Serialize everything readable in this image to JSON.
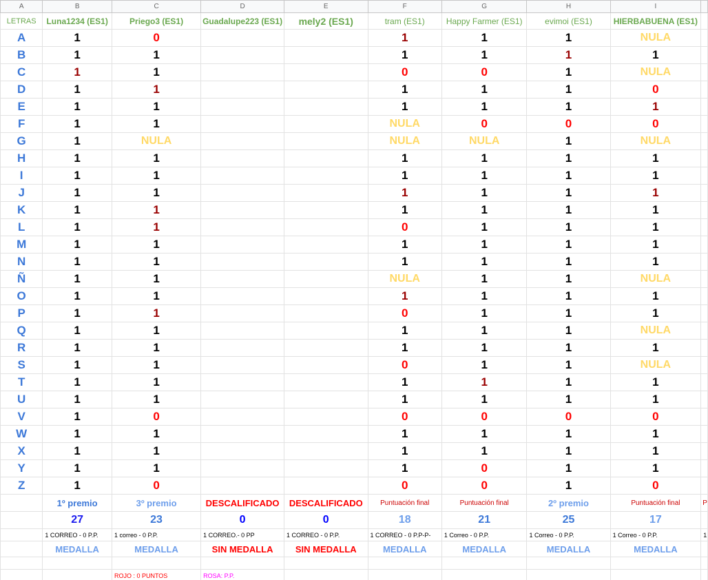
{
  "columns": [
    "A",
    "B",
    "C",
    "D",
    "E",
    "F",
    "G",
    "H",
    "I"
  ],
  "header_label": "LETRAS",
  "players": [
    "Luna1234 (ES1)",
    "Priego3 (ES1)",
    "Guadalupe223 (ES1)",
    "mely2 (ES1)",
    "tram (ES1)",
    "Happy Farmer (ES1)",
    "evimoi (ES1)",
    "HIERBABUENA (ES1)"
  ],
  "rows": [
    {
      "letter": "A",
      "values": [
        "1",
        "0",
        "",
        "",
        "1",
        "1",
        "1",
        "NULA"
      ]
    },
    {
      "letter": "B",
      "values": [
        "1",
        "1",
        "",
        "",
        "1",
        "1",
        "1",
        "1"
      ]
    },
    {
      "letter": "C",
      "values": [
        "1",
        "1",
        "",
        "",
        "0",
        "0",
        "1",
        "NULA"
      ]
    },
    {
      "letter": "D",
      "values": [
        "1",
        "1",
        "",
        "",
        "1",
        "1",
        "1",
        "0"
      ]
    },
    {
      "letter": "E",
      "values": [
        "1",
        "1",
        "",
        "",
        "1",
        "1",
        "1",
        "1"
      ]
    },
    {
      "letter": "F",
      "values": [
        "1",
        "1",
        "",
        "",
        "NULA",
        "0",
        "0",
        "0"
      ]
    },
    {
      "letter": "G",
      "values": [
        "1",
        "NULA",
        "",
        "",
        "NULA",
        "NULA",
        "1",
        "NULA"
      ]
    },
    {
      "letter": "H",
      "values": [
        "1",
        "1",
        "",
        "",
        "1",
        "1",
        "1",
        "1"
      ]
    },
    {
      "letter": "I",
      "values": [
        "1",
        "1",
        "",
        "",
        "1",
        "1",
        "1",
        "1"
      ]
    },
    {
      "letter": "J",
      "values": [
        "1",
        "1",
        "",
        "",
        "1",
        "1",
        "1",
        "1"
      ]
    },
    {
      "letter": "K",
      "values": [
        "1",
        "1",
        "",
        "",
        "1",
        "1",
        "1",
        "1"
      ]
    },
    {
      "letter": "L",
      "values": [
        "1",
        "1",
        "",
        "",
        "0",
        "1",
        "1",
        "1"
      ]
    },
    {
      "letter": "M",
      "values": [
        "1",
        "1",
        "",
        "",
        "1",
        "1",
        "1",
        "1"
      ]
    },
    {
      "letter": "N",
      "values": [
        "1",
        "1",
        "",
        "",
        "1",
        "1",
        "1",
        "1"
      ]
    },
    {
      "letter": "Ñ",
      "values": [
        "1",
        "1",
        "",
        "",
        "NULA",
        "1",
        "1",
        "NULA"
      ]
    },
    {
      "letter": "O",
      "values": [
        "1",
        "1",
        "",
        "",
        "1",
        "1",
        "1",
        "1"
      ]
    },
    {
      "letter": "P",
      "values": [
        "1",
        "1",
        "",
        "",
        "0",
        "1",
        "1",
        "1"
      ]
    },
    {
      "letter": "Q",
      "values": [
        "1",
        "1",
        "",
        "",
        "1",
        "1",
        "1",
        "NULA"
      ]
    },
    {
      "letter": "R",
      "values": [
        "1",
        "1",
        "",
        "",
        "1",
        "1",
        "1",
        "1"
      ]
    },
    {
      "letter": "S",
      "values": [
        "1",
        "1",
        "",
        "",
        "0",
        "1",
        "1",
        "NULA"
      ]
    },
    {
      "letter": "T",
      "values": [
        "1",
        "1",
        "",
        "",
        "1",
        "1",
        "1",
        "1"
      ]
    },
    {
      "letter": "U",
      "values": [
        "1",
        "1",
        "",
        "",
        "1",
        "1",
        "1",
        "1"
      ]
    },
    {
      "letter": "V",
      "values": [
        "1",
        "0",
        "",
        "",
        "0",
        "0",
        "0",
        "0"
      ]
    },
    {
      "letter": "W",
      "values": [
        "1",
        "1",
        "",
        "",
        "1",
        "1",
        "1",
        "1"
      ]
    },
    {
      "letter": "X",
      "values": [
        "1",
        "1",
        "",
        "",
        "1",
        "1",
        "1",
        "1"
      ]
    },
    {
      "letter": "Y",
      "values": [
        "1",
        "1",
        "",
        "",
        "1",
        "0",
        "1",
        "1"
      ]
    },
    {
      "letter": "Z",
      "values": [
        "1",
        "0",
        "",
        "",
        "0",
        "0",
        "1",
        "0"
      ]
    }
  ],
  "dark_red_cells": [
    "B:C",
    "C:D",
    "C:K",
    "C:L",
    "C:P",
    "F:A",
    "F:J",
    "F:O",
    "G:T",
    "H:B",
    "I:E",
    "I:J"
  ],
  "premios": [
    "1º premio",
    "3º premio",
    "DESCALIFICADO",
    "DESCALIFICADO",
    "Puntuación final",
    "Puntuación final",
    "2º premio",
    "Puntuación final",
    "P"
  ],
  "scores": [
    "27",
    "23",
    "0",
    "0",
    "18",
    "21",
    "25",
    "17"
  ],
  "correos": [
    "1 CORREO - 0 P.P.",
    "1 correo - 0 P.P.",
    "1 CORREO.- 0 PP",
    "1 CORREO - 0 P.P.",
    "1 CORREO - 0 P.P-P-",
    "1 Correo - 0  P.P.",
    "1 Correo - 0 P.P.",
    "1 Correo - 0 P.P.",
    "1"
  ],
  "medallas": [
    "MEDALLA",
    "MEDALLA",
    "SIN MEDALLA",
    "SIN MEDALLA",
    "MEDALLA",
    "MEDALLA",
    "MEDALLA",
    "MEDALLA"
  ],
  "legend": {
    "rojo": "ROJO : 0 PUNTOS",
    "rosa": "ROSA: P.P."
  },
  "colors": {
    "letter": "#3c78d8",
    "name": "#6aa84f",
    "zero": "#ff0000",
    "dark_red": "#990000",
    "nula": "#ffd966",
    "prize": "#6d9eeb",
    "disqualified": "#ff0000",
    "pink": "#ff00ff"
  }
}
